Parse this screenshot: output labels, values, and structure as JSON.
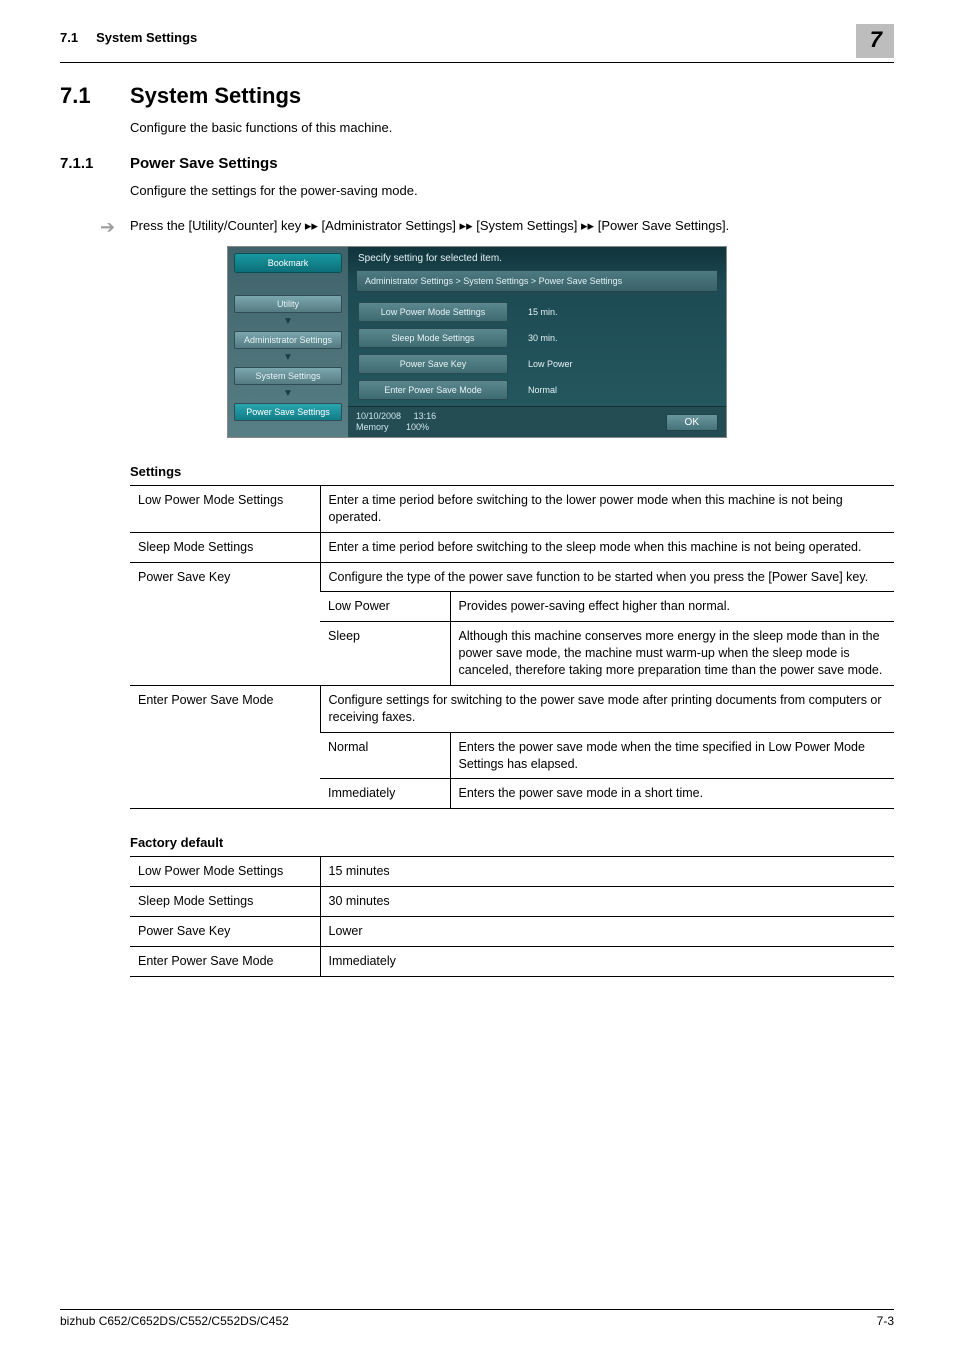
{
  "header": {
    "section_ref": "7.1",
    "section_name": "System Settings",
    "chapter_num": "7"
  },
  "h1": {
    "num": "7.1",
    "title": "System Settings",
    "intro": "Configure the basic functions of this machine."
  },
  "h2": {
    "num": "7.1.1",
    "title": "Power Save Settings",
    "intro": "Configure the settings for the power-saving mode."
  },
  "step": {
    "prefix": "Press the [Utility/Counter] key ",
    "s1": "[Administrator Settings]",
    "s2": "[System Settings]",
    "s3": "[Power Save Settings].",
    "arrows": "▸▸"
  },
  "device": {
    "bookmark": "Bookmark",
    "crumbs": [
      "Utility",
      "Administrator Settings",
      "System Settings",
      "Power Save Settings"
    ],
    "title": "Specify setting for selected item.",
    "path": "Administrator Settings > System Settings > Power Save Settings",
    "rows": [
      {
        "key": "Low Power Mode Settings",
        "val": "15 min."
      },
      {
        "key": "Sleep Mode Settings",
        "val": "30 min."
      },
      {
        "key": "Power Save Key",
        "val": "Low Power"
      },
      {
        "key": "Enter Power Save Mode",
        "val": "Normal"
      }
    ],
    "footer_date": "10/10/2008",
    "footer_time": "13:16",
    "footer_mem_label": "Memory",
    "footer_mem_val": "100%",
    "ok": "OK"
  },
  "settings_table": {
    "title": "Settings",
    "rows": {
      "lowpower": {
        "name": "Low Power Mode Settings",
        "desc": "Enter a time period before switching to the lower power mode when this machine is not being operated."
      },
      "sleep": {
        "name": "Sleep Mode Settings",
        "desc": "Enter a time period before switching to the sleep mode when this machine is not being operated."
      },
      "pskey": {
        "name": "Power Save Key",
        "desc": "Configure the type of the power save function to be started when you press the [Power Save] key.",
        "opt1_name": "Low Power",
        "opt1_desc": "Provides power-saving effect higher than normal.",
        "opt2_name": "Sleep",
        "opt2_desc": "Although this machine conserves more energy in the sleep mode than in the power save mode, the machine must warm-up when the sleep mode is canceled, therefore taking more preparation time than the power save mode."
      },
      "enter": {
        "name": "Enter Power Save Mode",
        "desc": "Configure settings for switching to the power save mode after printing documents from computers or receiving faxes.",
        "opt1_name": "Normal",
        "opt1_desc": "Enters the power save mode when the time specified in Low Power Mode Settings has elapsed.",
        "opt2_name": "Immediately",
        "opt2_desc": "Enters the power save mode in a short time."
      }
    }
  },
  "factory_table": {
    "title": "Factory default",
    "rows": [
      {
        "name": "Low Power Mode Settings",
        "val": "15 minutes"
      },
      {
        "name": "Sleep Mode Settings",
        "val": "30 minutes"
      },
      {
        "name": "Power Save Key",
        "val": "Lower"
      },
      {
        "name": "Enter Power Save Mode",
        "val": "Immediately"
      }
    ]
  },
  "footer": {
    "model": "bizhub C652/C652DS/C552/C552DS/C452",
    "page": "7-3"
  }
}
